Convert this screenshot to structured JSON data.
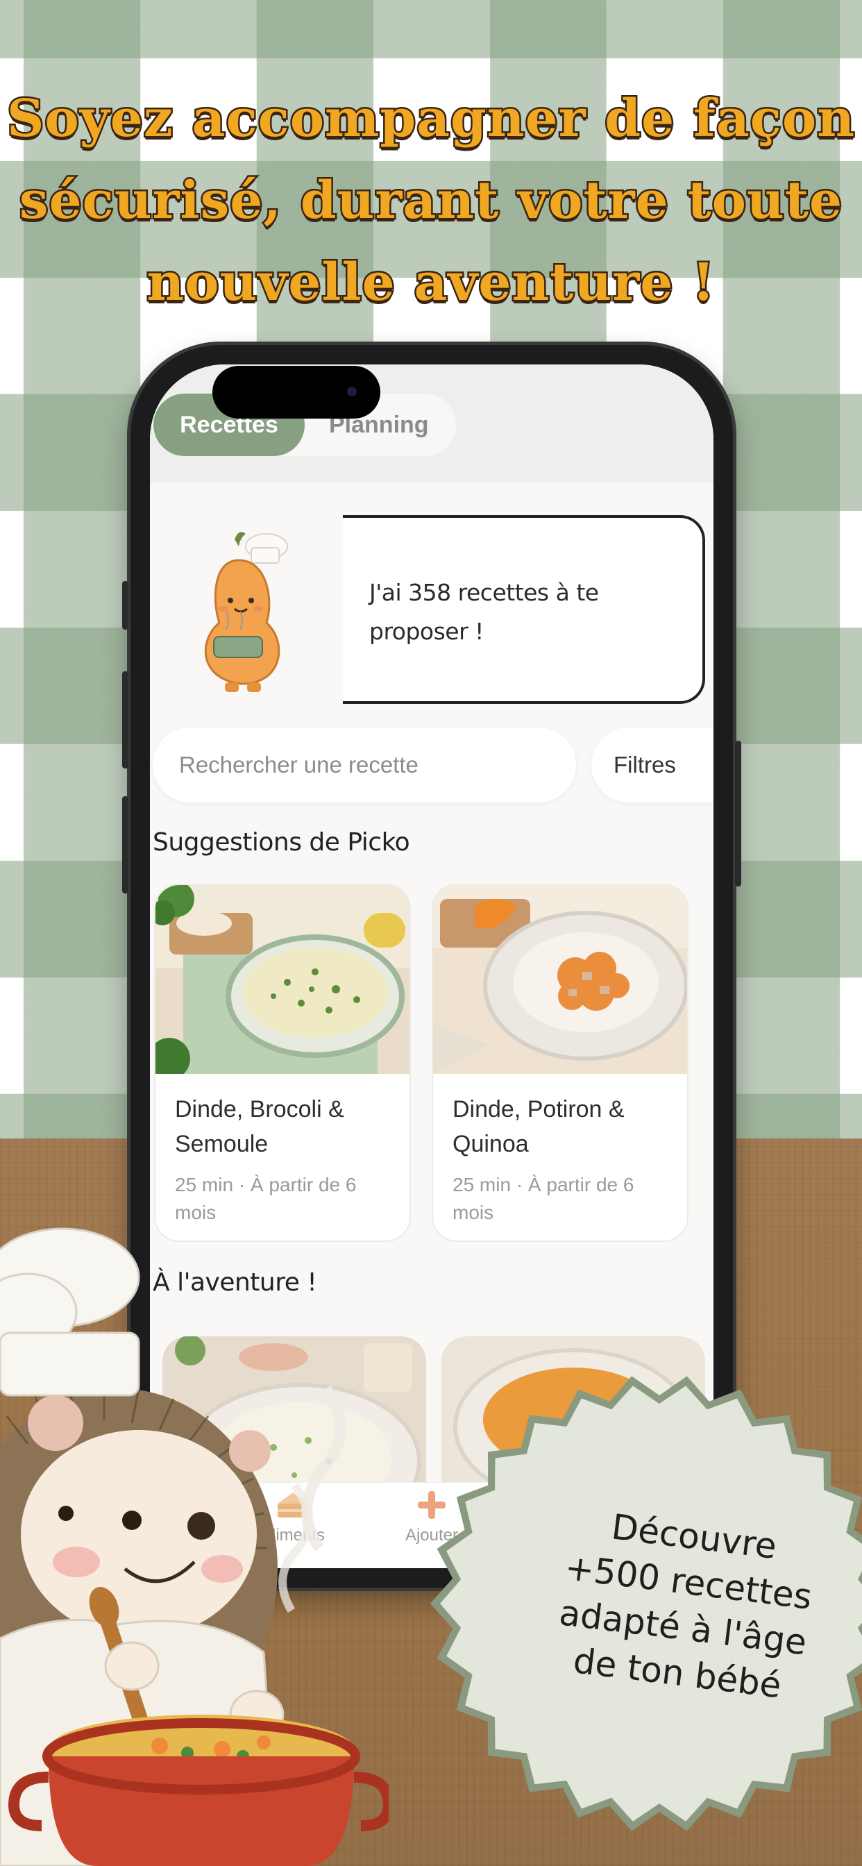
{
  "headline": {
    "line1": "Soyez accompagner de façon",
    "line2": "sécurisé, durant votre toute",
    "line3": "nouvelle aventure !"
  },
  "app": {
    "tabs": {
      "active": "Recettes",
      "other": "Planning"
    },
    "bubble_text": "J'ai 358 recettes à te proposer !",
    "search": {
      "placeholder": "Rechercher une recette"
    },
    "filter_label": "Filtres",
    "sections": [
      {
        "title": "Suggestions de Picko",
        "cards": [
          {
            "title": "Dinde, Brocoli & Semoule",
            "meta": "25 min · À partir de 6 mois"
          },
          {
            "title": "Dinde, Potiron & Quinoa",
            "meta": "25 min · À partir de 6 mois"
          }
        ]
      },
      {
        "title": "À l'aventure !"
      }
    ],
    "tabbar": [
      {
        "label": "Aliments",
        "icon": "cake-icon"
      },
      {
        "label": "Ajouter",
        "icon": "plus-icon"
      }
    ]
  },
  "badge": {
    "line1": "Découvre",
    "line2": "+500 recettes",
    "line3": "adapté à l'âge",
    "line4": "de ton bébé"
  },
  "colors": {
    "accent_green": "#86a081",
    "headline_orange": "#f0a722",
    "badge_fill": "#e3e6da",
    "badge_border": "#8a9a80"
  }
}
